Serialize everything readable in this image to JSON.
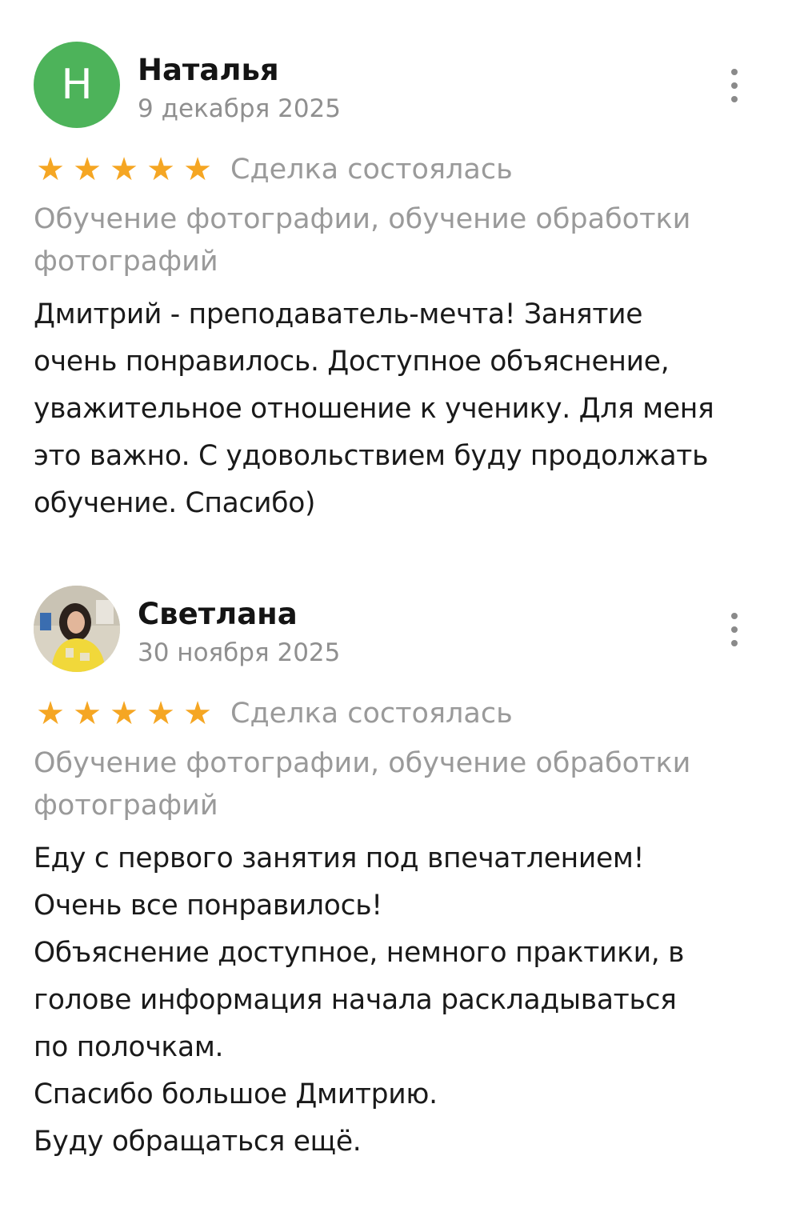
{
  "reviews": [
    {
      "avatar_letter": "Н",
      "author": "Наталья",
      "date": "9 декабря 2025",
      "rating": 5,
      "status": "Сделка состоялась",
      "service": "Обучение фотографии, обучение обработки фотографий",
      "text": "Дмитрий - преподаватель-мечта! Занятие\nочень понравилось. Доступное объяснение,\nуважительное отношение к ученику. Для меня\nэто важно. С удовольствием буду продолжать\nобучение. Спасибо)"
    },
    {
      "author": "Светлана",
      "date": "30 ноября 2025",
      "rating": 5,
      "status": "Сделка состоялась",
      "service": "Обучение фотографии, обучение обработки фотографий",
      "text": "Еду с первого занятия под впечатлением!\nОчень все понравилось!\nОбъяснение доступное, немного практики, в\nголове информация начала раскладываться\nпо полочкам.\nСпасибо большое Дмитрию.\nБуду обращаться ещё."
    }
  ],
  "colors": {
    "star": "#f5a623",
    "avatar_green": "#4db35a",
    "muted_text": "#9a9a9a",
    "primary_text": "#1a1a1a"
  },
  "icons": {
    "star": "star-icon",
    "more": "more-vertical-icon"
  }
}
